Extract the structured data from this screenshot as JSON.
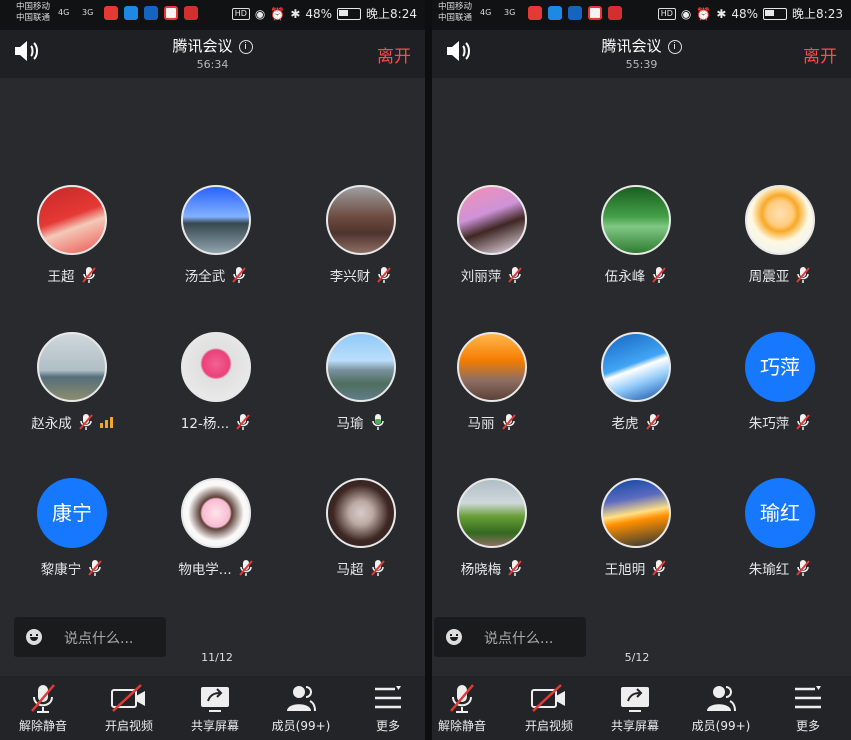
{
  "left": {
    "status": {
      "carrier1": "中国移动",
      "carrier2": "中国联通",
      "sig1": "4G",
      "sig2": "3G",
      "battery": "48%",
      "time": "晚上8:24"
    },
    "title": "腾讯会议",
    "duration": "56:34",
    "leave": "离开",
    "participants": [
      {
        "name": "王超",
        "avatar": "photo",
        "mic": "muted"
      },
      {
        "name": "汤全武",
        "avatar": "photo",
        "mic": "muted"
      },
      {
        "name": "李兴财",
        "avatar": "photo",
        "mic": "muted"
      },
      {
        "name": "赵永成",
        "avatar": "photo",
        "mic": "muted",
        "signal": true
      },
      {
        "name": "12-杨...",
        "avatar": "photo",
        "mic": "muted"
      },
      {
        "name": "马瑜",
        "avatar": "photo",
        "mic": "on"
      },
      {
        "name": "黎康宁",
        "avatar": "text",
        "avatar_text": "康宁",
        "mic": "muted"
      },
      {
        "name": "物电学...",
        "avatar": "photo",
        "mic": "muted"
      },
      {
        "name": "马超",
        "avatar": "photo",
        "mic": "muted"
      }
    ],
    "chat_placeholder": "说点什么...",
    "page": "11/12",
    "toolbar": {
      "unmute": "解除静音",
      "video": "开启视频",
      "share": "共享屏幕",
      "members": "成员(99+)",
      "more": "更多"
    }
  },
  "right": {
    "status": {
      "carrier1": "中国移动",
      "carrier2": "中国联通",
      "sig1": "4G",
      "sig2": "3G",
      "battery": "48%",
      "time": "晚上8:23"
    },
    "title": "腾讯会议",
    "duration": "55:39",
    "leave": "离开",
    "participants": [
      {
        "name": "刘丽萍",
        "avatar": "photo",
        "mic": "muted"
      },
      {
        "name": "伍永峰",
        "avatar": "photo",
        "mic": "muted"
      },
      {
        "name": "周震亚",
        "avatar": "photo",
        "mic": "muted"
      },
      {
        "name": "马丽",
        "avatar": "photo",
        "mic": "muted"
      },
      {
        "name": "老虎",
        "avatar": "photo",
        "mic": "muted"
      },
      {
        "name": "朱巧萍",
        "avatar": "text",
        "avatar_text": "巧萍",
        "mic": "muted"
      },
      {
        "name": "杨晓梅",
        "avatar": "photo",
        "mic": "muted"
      },
      {
        "name": "王旭明",
        "avatar": "photo",
        "mic": "muted"
      },
      {
        "name": "朱瑜红",
        "avatar": "text",
        "avatar_text": "瑜红",
        "mic": "muted"
      }
    ],
    "chat_placeholder": "说点什么...",
    "page": "5/12",
    "toolbar": {
      "unmute": "解除静音",
      "video": "开启视频",
      "share": "共享屏幕",
      "members": "成员(99+)",
      "more": "更多"
    }
  },
  "colors": {
    "accent_blue": "#1677ff",
    "leave_red": "#ff4a4a",
    "muted_red": "#e53935",
    "signal_orange": "#f5a623"
  }
}
